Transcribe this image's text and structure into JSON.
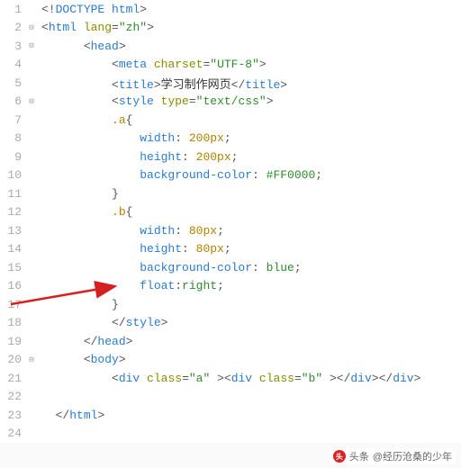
{
  "lines": [
    {
      "n": 1,
      "fold": "",
      "tokens": [
        [
          "punct",
          "<!"
        ],
        [
          "tag",
          "DOCTYPE html"
        ],
        [
          "punct",
          ">"
        ]
      ]
    },
    {
      "n": 2,
      "fold": "⊟",
      "tokens": [
        [
          "punct",
          "<"
        ],
        [
          "tag",
          "html "
        ],
        [
          "attr",
          "lang"
        ],
        [
          "punct",
          "="
        ],
        [
          "str",
          "\"zh\""
        ],
        [
          "punct",
          ">"
        ]
      ]
    },
    {
      "n": 3,
      "fold": "⊟",
      "tokens": [
        [
          "txt",
          "      "
        ],
        [
          "punct",
          "<"
        ],
        [
          "tag",
          "head"
        ],
        [
          "punct",
          ">"
        ]
      ]
    },
    {
      "n": 4,
      "fold": "",
      "tokens": [
        [
          "txt",
          "          "
        ],
        [
          "punct",
          "<"
        ],
        [
          "tag",
          "meta "
        ],
        [
          "attr",
          "charset"
        ],
        [
          "punct",
          "="
        ],
        [
          "str",
          "\"UTF-8\""
        ],
        [
          "punct",
          ">"
        ]
      ]
    },
    {
      "n": 5,
      "fold": "",
      "tokens": [
        [
          "txt",
          "          "
        ],
        [
          "punct",
          "<"
        ],
        [
          "tag",
          "title"
        ],
        [
          "punct",
          ">"
        ],
        [
          "txt",
          "学习制作网页"
        ],
        [
          "punct",
          "</"
        ],
        [
          "tag",
          "title"
        ],
        [
          "punct",
          ">"
        ]
      ]
    },
    {
      "n": 6,
      "fold": "⊟",
      "tokens": [
        [
          "txt",
          "          "
        ],
        [
          "punct",
          "<"
        ],
        [
          "tag",
          "style "
        ],
        [
          "attr",
          "type"
        ],
        [
          "punct",
          "="
        ],
        [
          "str",
          "\"text/css\""
        ],
        [
          "punct",
          ">"
        ]
      ]
    },
    {
      "n": 7,
      "fold": "",
      "tokens": [
        [
          "txt",
          "          "
        ],
        [
          "css-sel",
          ".a"
        ],
        [
          "punct",
          "{"
        ]
      ]
    },
    {
      "n": 8,
      "fold": "",
      "tokens": [
        [
          "txt",
          "              "
        ],
        [
          "css-prop",
          "width"
        ],
        [
          "punct",
          ": "
        ],
        [
          "css-num",
          "200px"
        ],
        [
          "punct",
          ";"
        ]
      ]
    },
    {
      "n": 9,
      "fold": "",
      "tokens": [
        [
          "txt",
          "              "
        ],
        [
          "css-prop",
          "height"
        ],
        [
          "punct",
          ": "
        ],
        [
          "css-num",
          "200px"
        ],
        [
          "punct",
          ";"
        ]
      ]
    },
    {
      "n": 10,
      "fold": "",
      "tokens": [
        [
          "txt",
          "              "
        ],
        [
          "css-prop",
          "background-color"
        ],
        [
          "punct",
          ": "
        ],
        [
          "css-val",
          "#FF0000"
        ],
        [
          "punct",
          ";"
        ]
      ]
    },
    {
      "n": 11,
      "fold": "",
      "tokens": [
        [
          "txt",
          "          "
        ],
        [
          "punct",
          "}"
        ]
      ]
    },
    {
      "n": 12,
      "fold": "",
      "tokens": [
        [
          "txt",
          "          "
        ],
        [
          "css-sel",
          ".b"
        ],
        [
          "punct",
          "{"
        ]
      ]
    },
    {
      "n": 13,
      "fold": "",
      "tokens": [
        [
          "txt",
          "              "
        ],
        [
          "css-prop",
          "width"
        ],
        [
          "punct",
          ": "
        ],
        [
          "css-num",
          "80px"
        ],
        [
          "punct",
          ";"
        ]
      ]
    },
    {
      "n": 14,
      "fold": "",
      "tokens": [
        [
          "txt",
          "              "
        ],
        [
          "css-prop",
          "height"
        ],
        [
          "punct",
          ": "
        ],
        [
          "css-num",
          "80px"
        ],
        [
          "punct",
          ";"
        ]
      ]
    },
    {
      "n": 15,
      "fold": "",
      "tokens": [
        [
          "txt",
          "              "
        ],
        [
          "css-prop",
          "background-color"
        ],
        [
          "punct",
          ": "
        ],
        [
          "css-val",
          "blue"
        ],
        [
          "punct",
          ";"
        ]
      ]
    },
    {
      "n": 16,
      "fold": "",
      "tokens": [
        [
          "txt",
          "              "
        ],
        [
          "css-prop",
          "float"
        ],
        [
          "punct",
          ":"
        ],
        [
          "css-val",
          "right"
        ],
        [
          "punct",
          ";"
        ]
      ]
    },
    {
      "n": 17,
      "fold": "",
      "tokens": [
        [
          "txt",
          "          "
        ],
        [
          "punct",
          "}"
        ]
      ]
    },
    {
      "n": 18,
      "fold": "",
      "tokens": [
        [
          "txt",
          "          "
        ],
        [
          "punct",
          "</"
        ],
        [
          "tag",
          "style"
        ],
        [
          "punct",
          ">"
        ]
      ]
    },
    {
      "n": 19,
      "fold": "",
      "tokens": [
        [
          "txt",
          "      "
        ],
        [
          "punct",
          "</"
        ],
        [
          "tag",
          "head"
        ],
        [
          "punct",
          ">"
        ]
      ]
    },
    {
      "n": 20,
      "fold": "⊟",
      "tokens": [
        [
          "txt",
          "      "
        ],
        [
          "punct",
          "<"
        ],
        [
          "tag",
          "body"
        ],
        [
          "punct",
          ">"
        ]
      ]
    },
    {
      "n": 21,
      "fold": "",
      "tokens": [
        [
          "txt",
          "          "
        ],
        [
          "punct",
          "<"
        ],
        [
          "tag",
          "div "
        ],
        [
          "attr",
          "class"
        ],
        [
          "punct",
          "="
        ],
        [
          "str",
          "\"a\""
        ],
        [
          "txt",
          " "
        ],
        [
          "punct",
          "><"
        ],
        [
          "tag",
          "div "
        ],
        [
          "attr",
          "class"
        ],
        [
          "punct",
          "="
        ],
        [
          "str",
          "\"b\""
        ],
        [
          "txt",
          " "
        ],
        [
          "punct",
          "></"
        ],
        [
          "tag",
          "div"
        ],
        [
          "punct",
          "></"
        ],
        [
          "tag",
          "div"
        ],
        [
          "punct",
          ">"
        ]
      ]
    },
    {
      "n": 22,
      "fold": "",
      "tokens": []
    },
    {
      "n": 23,
      "fold": "",
      "tokens": [
        [
          "txt",
          "  "
        ],
        [
          "punct",
          "</"
        ],
        [
          "tag",
          "html"
        ],
        [
          "punct",
          ">"
        ]
      ]
    },
    {
      "n": 24,
      "fold": "",
      "tokens": []
    }
  ],
  "watermark": {
    "prefix": "头条",
    "suffix": "@经历沧桑的少年"
  },
  "arrow": {
    "color": "#d62020"
  }
}
